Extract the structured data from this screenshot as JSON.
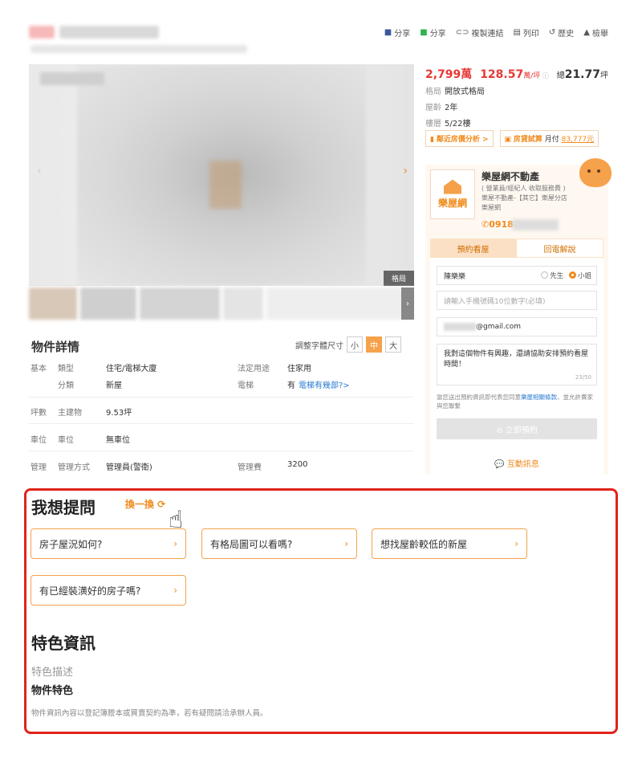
{
  "toolbar": {
    "items": [
      {
        "label": "分享",
        "icon": "facebook-icon"
      },
      {
        "label": "分享",
        "icon": "line-icon"
      },
      {
        "label": "複製連結",
        "icon": "link-icon"
      },
      {
        "label": "列印",
        "icon": "printer-icon"
      },
      {
        "label": "歷史",
        "icon": "history-icon"
      },
      {
        "label": "檢舉",
        "icon": "warning-icon"
      }
    ]
  },
  "gallery": {
    "layout_tag": "格局"
  },
  "details": {
    "title": "物件詳情",
    "font_size_label": "調整字體尺寸",
    "font_sizes": [
      "小",
      "中",
      "大"
    ],
    "rows": [
      {
        "group": "基本",
        "label": "類型",
        "value": "住宅/電梯大廈",
        "label2": "法定用途",
        "value2": "住家用"
      },
      {
        "group": "",
        "label": "分類",
        "value": "新屋",
        "label2": "電梯",
        "value2": "有",
        "link": "電梯有幾部?>"
      },
      {
        "group": "坪數",
        "label": "主建物",
        "value": "9.53坪"
      },
      {
        "group": "車位",
        "label": "車位",
        "value": "無車位"
      },
      {
        "group": "管理",
        "label": "管理方式",
        "value": "管理員(警衛)",
        "label2": "管理費",
        "value2": "3200"
      }
    ]
  },
  "price": {
    "total": "2,799萬",
    "unit_price": "128.57",
    "unit_label": "萬/坪",
    "area_prefix": "總",
    "area": "21.77",
    "area_unit": "坪",
    "info": [
      {
        "label": "格局",
        "value": "開放式格局"
      },
      {
        "label": "屋齡",
        "value": "2年"
      },
      {
        "label": "樓層",
        "value": "5/22樓"
      }
    ],
    "tool1": "鄰近房價分析 >",
    "tool2_label": "房貸試算",
    "tool2_prefix": "月付",
    "tool2_value": "83,777元"
  },
  "agent": {
    "logo_text": "樂屋網",
    "name": "樂屋網不動產",
    "note": "( 營業員/經紀人 收取服務費 )",
    "company": "樂屋不動產-【其它】樂屋分店",
    "brand": "樂屋網",
    "phone": "0918-",
    "tabs": [
      "預約看屋",
      "回電解說"
    ],
    "name_value": "陳樂樂",
    "gender_options": [
      "先生",
      "小姐"
    ],
    "phone_placeholder": "請輸入手機號碼10位數字(必填)",
    "email_value": "@gmail.com",
    "message_value": "我對這個物件有興趣，還請協助安排預約看屋時間！",
    "message_count": "23/50",
    "terms": "當您送出預約資訊即代表您同意",
    "terms_link": "樂屋相關條款",
    "terms_tail": "，並允許賣家與您聯繫",
    "submit": "⊘ 立即預約",
    "chat": "互動訊息"
  },
  "ask": {
    "title": "我想提問",
    "swap": "換一換",
    "questions": [
      "房子屋況如何?",
      "有格局圖可以看嗎?",
      "想找屋齡較低的新屋",
      "有已經裝潢好的房子嗎?"
    ]
  },
  "features": {
    "title": "特色資訊",
    "desc_label": "特色描述",
    "sub_title": "物件特色",
    "note": "物件資訊內容以登記簿謄本或買賣契約為準，若有疑問請洽承辦人員。"
  },
  "colors": {
    "accent": "#f08a1a",
    "price": "#e53935",
    "highlight": "#e2231a"
  }
}
